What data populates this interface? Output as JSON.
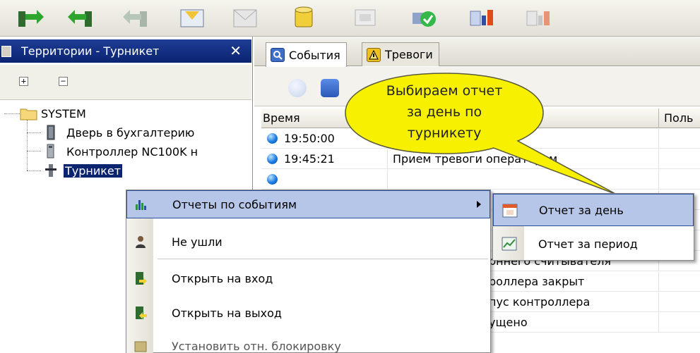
{
  "toolbar": {
    "buttons": [
      {
        "icon": "enter-door-icon"
      },
      {
        "icon": "exit-door-icon"
      },
      {
        "icon": "exit-door-disabled-icon"
      },
      {
        "icon": "envelope-icon"
      },
      {
        "icon": "mail-disabled-icon"
      },
      {
        "icon": "database-icon"
      },
      {
        "icon": "image-disabled-icon"
      },
      {
        "icon": "shield-check-icon"
      },
      {
        "icon": "report-chart-icon"
      },
      {
        "icon": "report-chart-disabled-icon"
      }
    ]
  },
  "left_panel": {
    "title": "Территории - Турникет",
    "close_glyph": "✕",
    "expand_all": "+",
    "collapse_all": "−",
    "tree": {
      "root": "SYSTEM",
      "children": [
        "Дверь в бухгалтерию",
        "Контроллер NC100K н",
        "Турникет"
      ]
    }
  },
  "right_panel": {
    "tabs": [
      {
        "label": "События",
        "icon": "events-icon"
      },
      {
        "label": "Тревоги",
        "icon": "alarm-icon"
      }
    ],
    "grid": {
      "columns": [
        "Время",
        "Поль"
      ],
      "rows": [
        {
          "time": "19:50:00",
          "event": ""
        },
        {
          "time": "19:45:21",
          "event": "Прием тревоги оператором"
        },
        {
          "time": "",
          "event": "Вскрыт корпус внешнего считывателя"
        },
        {
          "time": "",
          "event": "Корпус контроллера закрыт"
        },
        {
          "time": "",
          "event": "Вскрыт корпус контроллера"
        },
        {
          "time": "",
          "event": "Прощено"
        }
      ],
      "partial_texts": [
        "рннего считывателя",
        "роллера закрыт",
        "пус контроллера",
        "ущено"
      ]
    }
  },
  "context_menu": {
    "items": [
      {
        "label": "Отчеты по событиям",
        "icon": "bar-chart-icon",
        "has_submenu": true
      },
      {
        "label": "Не ушли",
        "icon": "person-icon"
      },
      {
        "label": "Открыть на вход",
        "icon": "door-enter-icon"
      },
      {
        "label": "Открыть на выход",
        "icon": "door-exit-icon"
      },
      {
        "label": "Установить отн. блокировку",
        "icon": "lock-icon"
      }
    ]
  },
  "submenu": {
    "items": [
      {
        "label": "Отчет за день",
        "icon": "calendar-day-icon"
      },
      {
        "label": "Отчет за период",
        "icon": "chart-period-icon"
      }
    ]
  },
  "callout": {
    "text_lines": [
      "Выбираем отчет",
      "за день по",
      "турникету"
    ],
    "fill": "#f7f100",
    "stroke": "#5a5a3a"
  },
  "colors": {
    "selection": "#0a2470",
    "menu_hot": "#b6c6e8",
    "title_bar": "#0a2470"
  }
}
